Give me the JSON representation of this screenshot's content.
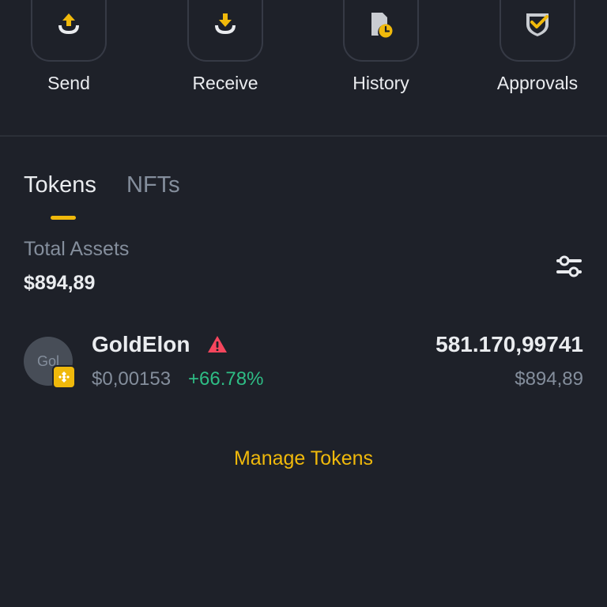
{
  "actions": [
    {
      "label": "Send",
      "icon": "send-icon"
    },
    {
      "label": "Receive",
      "icon": "receive-icon"
    },
    {
      "label": "History",
      "icon": "history-icon"
    },
    {
      "label": "Approvals",
      "icon": "approvals-icon"
    }
  ],
  "tabs": {
    "tokens": "Tokens",
    "nfts": "NFTs",
    "active": "tokens"
  },
  "summary": {
    "total_assets_label": "Total Assets",
    "total_assets_value": "$894,89"
  },
  "tokens": [
    {
      "name": "GoldElon",
      "avatar_text": "Gol",
      "price": "$0,00153",
      "change": "+66.78%",
      "amount": "581.170,99741",
      "value": "$894,89",
      "warning": true
    }
  ],
  "manage_tokens_label": "Manage Tokens",
  "colors": {
    "background": "#1e2129",
    "accent": "#f0b90b",
    "positive": "#2ebd85",
    "warning": "#f6465d",
    "muted": "#848e9c"
  }
}
